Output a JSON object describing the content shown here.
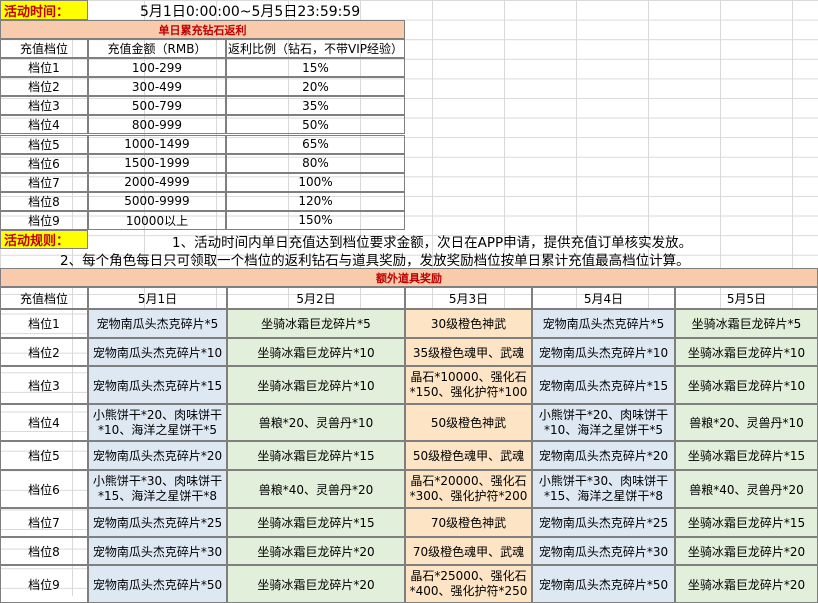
{
  "event_time": {
    "label": "活动时间：",
    "value": "5月1日0:00:00~5月5日23:59:59"
  },
  "rebate": {
    "title": "单日累充钻石返利",
    "headers": [
      "充值档位",
      "充值金额（RMB）",
      "返利比例（钻石，不带VIP经验）"
    ],
    "rows": [
      [
        "档位1",
        "100-299",
        "15%"
      ],
      [
        "档位2",
        "300-499",
        "20%"
      ],
      [
        "档位3",
        "500-799",
        "35%"
      ],
      [
        "档位4",
        "800-999",
        "50%"
      ],
      [
        "档位5",
        "1000-1499",
        "65%"
      ],
      [
        "档位6",
        "1500-1999",
        "80%"
      ],
      [
        "档位7",
        "2000-4999",
        "100%"
      ],
      [
        "档位8",
        "5000-9999",
        "120%"
      ],
      [
        "档位9",
        "10000以上",
        "150%"
      ]
    ]
  },
  "rules": {
    "label": "活动规则：",
    "line1": "1、活动时间内单日充值达到档位要求金额，次日在APP申请，提供充值订单核实发放。",
    "line2": "2、每个角色每日只可领取一个档位的返利钻石与道具奖励，发放奖励档位按单日累计充值最高档位计算。"
  },
  "extra": {
    "title": "额外道具奖励",
    "headers": [
      "充值档位",
      "5月1日",
      "5月2日",
      "5月3日",
      "5月4日",
      "5月5日"
    ],
    "rows": [
      [
        "档位1",
        "宠物南瓜头杰克碎片*5",
        "坐骑冰霜巨龙碎片*5",
        "30级橙色神武",
        "宠物南瓜头杰克碎片*5",
        "坐骑冰霜巨龙碎片*5"
      ],
      [
        "档位2",
        "宠物南瓜头杰克碎片*10",
        "坐骑冰霜巨龙碎片*10",
        "35级橙色魂甲、武魂",
        "宠物南瓜头杰克碎片*10",
        "坐骑冰霜巨龙碎片*10"
      ],
      [
        "档位3",
        "宠物南瓜头杰克碎片*15",
        "坐骑冰霜巨龙碎片*10",
        "晶石*10000、强化石*150、强化护符*100",
        "宠物南瓜头杰克碎片*15",
        "坐骑冰霜巨龙碎片*10"
      ],
      [
        "档位4",
        "小熊饼干*20、肉味饼干*10、海洋之星饼干*5",
        "兽粮*20、灵兽丹*10",
        "50级橙色神武",
        "小熊饼干*20、肉味饼干*10、海洋之星饼干*5",
        "兽粮*20、灵兽丹*10"
      ],
      [
        "档位5",
        "宠物南瓜头杰克碎片*20",
        "坐骑冰霜巨龙碎片*15",
        "50级橙色魂甲、武魂",
        "宠物南瓜头杰克碎片*20",
        "坐骑冰霜巨龙碎片*15"
      ],
      [
        "档位6",
        "小熊饼干*30、肉味饼干*15、海洋之星饼干*8",
        "兽粮*40、灵兽丹*20",
        "晶石*20000、强化石*300、强化护符*200",
        "小熊饼干*30、肉味饼干*15、海洋之星饼干*8",
        "兽粮*40、灵兽丹*20"
      ],
      [
        "档位7",
        "宠物南瓜头杰克碎片*25",
        "坐骑冰霜巨龙碎片*15",
        "70级橙色神武",
        "宠物南瓜头杰克碎片*25",
        "坐骑冰霜巨龙碎片*15"
      ],
      [
        "档位8",
        "宠物南瓜头杰克碎片*30",
        "坐骑冰霜巨龙碎片*20",
        "70级橙色魂甲、武魂",
        "宠物南瓜头杰克碎片*30",
        "坐骑冰霜巨龙碎片*20"
      ],
      [
        "档位9",
        "宠物南瓜头杰克碎片*50",
        "坐骑冰霜巨龙碎片*20",
        "晶石*25000、强化石*400、强化护符*250",
        "宠物南瓜头杰克碎片*50",
        "坐骑冰霜巨龙碎片*20"
      ]
    ]
  },
  "colors": {
    "blue": "#dde8f3",
    "green": "#e2efda",
    "orange": "#fce4c4",
    "highlight": "#ffff00",
    "section": "#f8cbad",
    "accent": "#c00000"
  }
}
